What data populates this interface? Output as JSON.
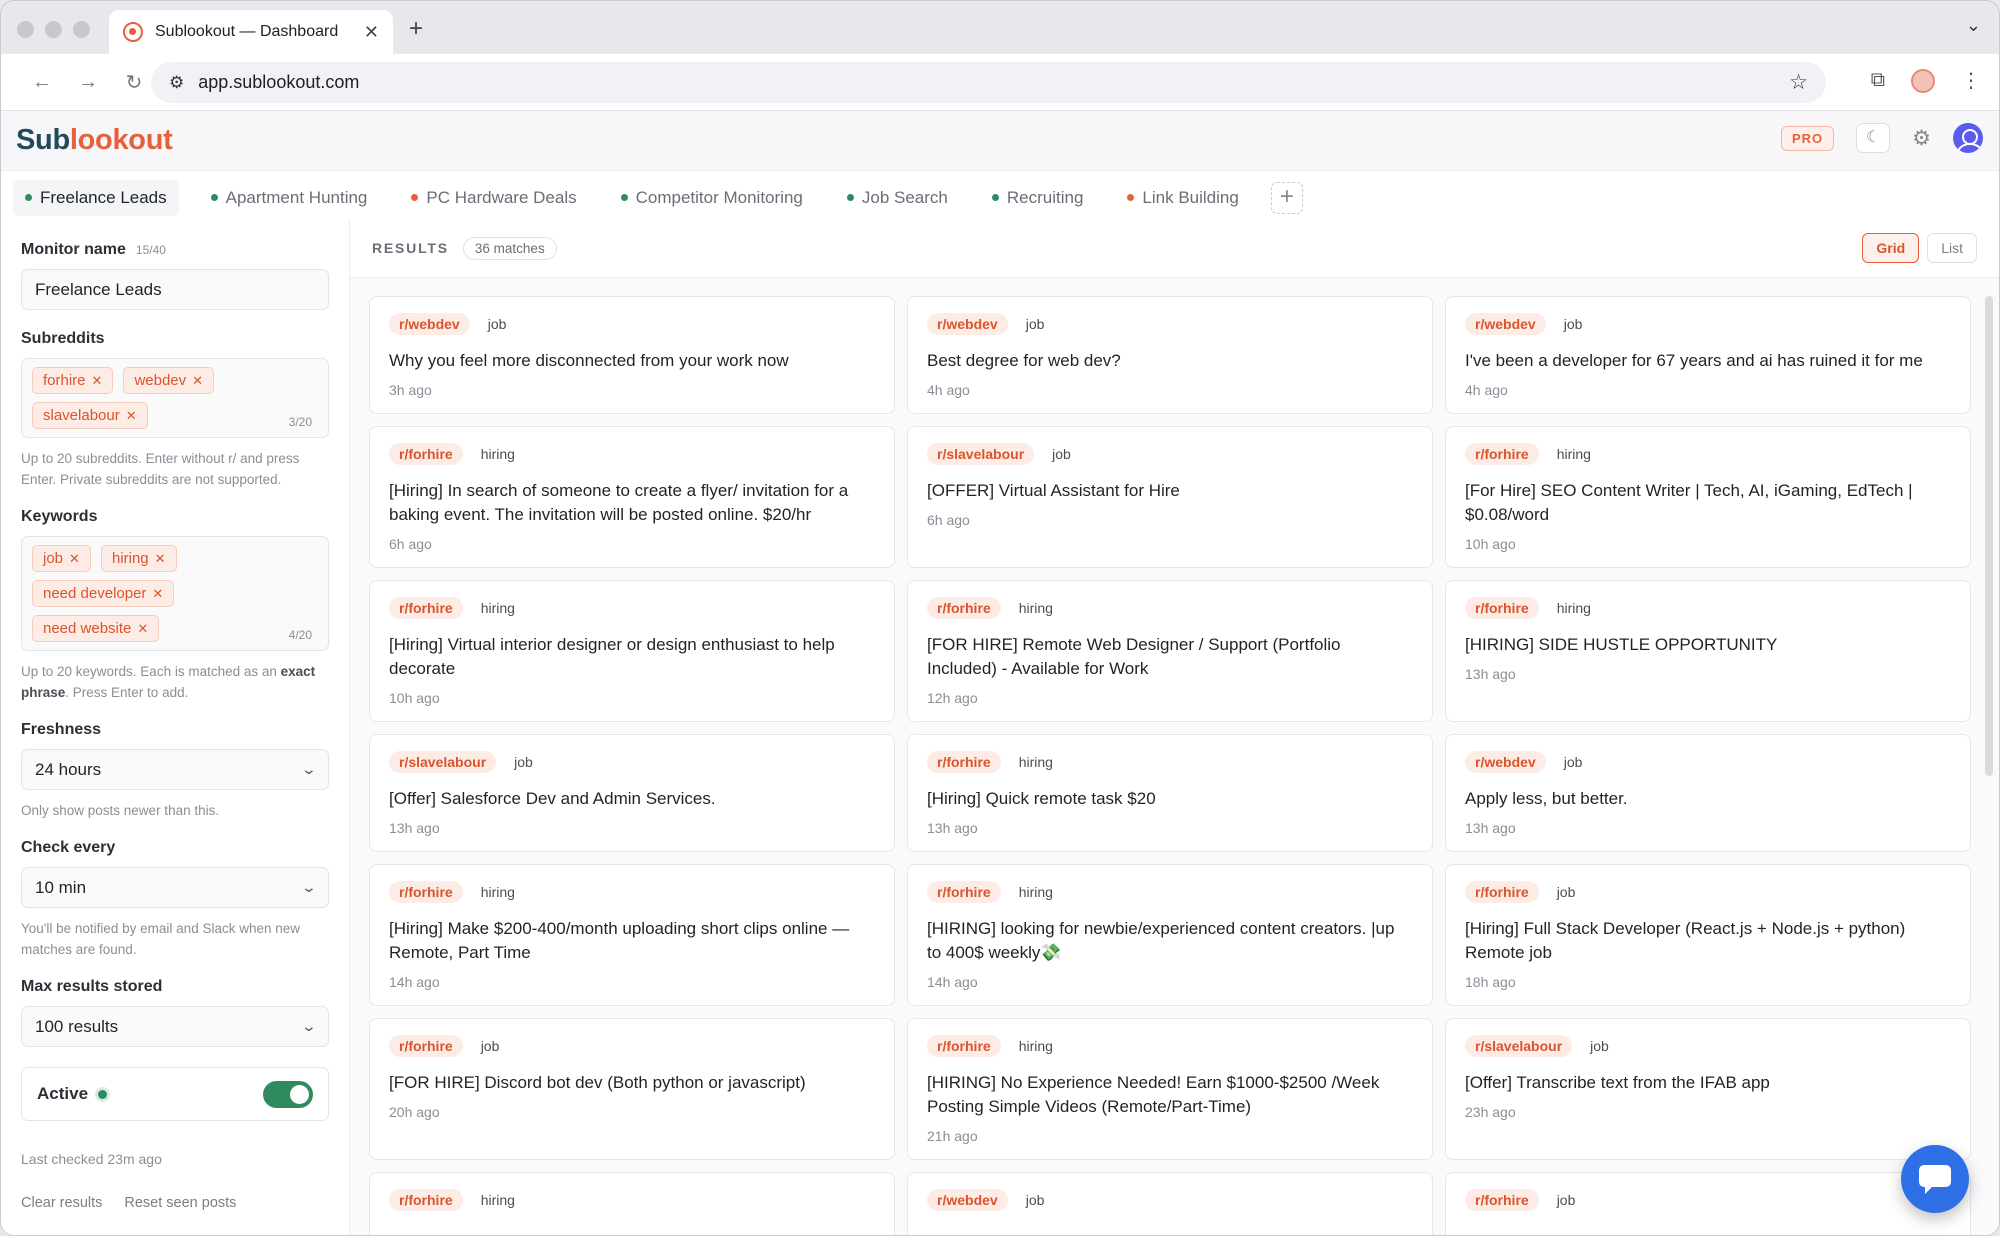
{
  "browser": {
    "tab_title": "Sublookout — Dashboard",
    "url": "app.sublookout.com"
  },
  "app": {
    "logo_part1": "Sub",
    "logo_part2": "lookout",
    "pro_badge": "PRO",
    "accent_color": "#e8603a"
  },
  "monitor_tabs": [
    {
      "label": "Freelance Leads",
      "dot": "green",
      "active": true
    },
    {
      "label": "Apartment Hunting",
      "dot": "green"
    },
    {
      "label": "PC Hardware Deals",
      "dot": "orange"
    },
    {
      "label": "Competitor Monitoring",
      "dot": "green"
    },
    {
      "label": "Job Search",
      "dot": "green"
    },
    {
      "label": "Recruiting",
      "dot": "green"
    },
    {
      "label": "Link Building",
      "dot": "orange"
    }
  ],
  "sidebar": {
    "monitor_name_label": "Monitor name",
    "monitor_name_count": "15/40",
    "monitor_name_value": "Freelance Leads",
    "subreddits_label": "Subreddits",
    "subreddits": [
      "forhire",
      "webdev",
      "slavelabour"
    ],
    "subreddits_count": "3/20",
    "subreddits_help": "Up to 20 subreddits. Enter without r/ and press Enter. Private subreddits are not supported.",
    "keywords_label": "Keywords",
    "keywords": [
      "job",
      "hiring",
      "need developer",
      "need website"
    ],
    "keywords_count": "4/20",
    "keywords_help_1": "Up to 20 keywords. Each is matched as an ",
    "keywords_help_bold": "exact phrase",
    "keywords_help_2": ". Press Enter to add.",
    "freshness_label": "Freshness",
    "freshness_value": "24 hours",
    "freshness_help": "Only show posts newer than this.",
    "check_label": "Check every",
    "check_value": "10 min",
    "check_help": "You'll be notified by email and Slack when new matches are found.",
    "max_label": "Max results stored",
    "max_value": "100 results",
    "active_label": "Active",
    "last_checked": "Last checked 23m ago",
    "clear_results": "Clear results",
    "reset_seen": "Reset seen posts"
  },
  "results": {
    "label": "RESULTS",
    "matches": "36 matches",
    "grid_label": "Grid",
    "list_label": "List",
    "cards": [
      {
        "sub": "r/webdev",
        "kw": "job",
        "title": "Why you feel more disconnected from your work now",
        "time": "3h ago"
      },
      {
        "sub": "r/webdev",
        "kw": "job",
        "title": "Best degree for web dev?",
        "time": "4h ago"
      },
      {
        "sub": "r/webdev",
        "kw": "job",
        "title": "I've been a developer for 67 years and ai has ruined it for me",
        "time": "4h ago"
      },
      {
        "sub": "r/forhire",
        "kw": "hiring",
        "title": "[Hiring] In search of someone to create a flyer/ invitation for a baking event. The invitation will be posted online. $20/hr",
        "time": "6h ago"
      },
      {
        "sub": "r/slavelabour",
        "kw": "job",
        "title": "[OFFER] Virtual Assistant for Hire",
        "time": "6h ago"
      },
      {
        "sub": "r/forhire",
        "kw": "hiring",
        "title": "[For Hire] SEO Content Writer | Tech, AI, iGaming, EdTech | $0.08/word",
        "time": "10h ago"
      },
      {
        "sub": "r/forhire",
        "kw": "hiring",
        "title": "[Hiring] Virtual interior designer or design enthusiast to help decorate",
        "time": "10h ago"
      },
      {
        "sub": "r/forhire",
        "kw": "hiring",
        "title": "[FOR HIRE] Remote Web Designer / Support (Portfolio Included) - Available for Work",
        "time": "12h ago"
      },
      {
        "sub": "r/forhire",
        "kw": "hiring",
        "title": "[HIRING] SIDE HUSTLE OPPORTUNITY",
        "time": "13h ago"
      },
      {
        "sub": "r/slavelabour",
        "kw": "job",
        "title": "[Offer] Salesforce Dev and Admin Services.",
        "time": "13h ago"
      },
      {
        "sub": "r/forhire",
        "kw": "hiring",
        "title": "[Hiring] Quick remote task $20",
        "time": "13h ago"
      },
      {
        "sub": "r/webdev",
        "kw": "job",
        "title": "Apply less, but better.",
        "time": "13h ago"
      },
      {
        "sub": "r/forhire",
        "kw": "hiring",
        "title": "[Hiring] Make $200-400/month uploading short clips online — Remote, Part Time",
        "time": "14h ago"
      },
      {
        "sub": "r/forhire",
        "kw": "hiring",
        "title": "[HIRING] looking for newbie/experienced content creators. |up to 400$ weekly💸",
        "time": "14h ago"
      },
      {
        "sub": "r/forhire",
        "kw": "job",
        "title": "[Hiring] Full Stack Developer (React.js + Node.js + python) Remote job",
        "time": "18h ago"
      },
      {
        "sub": "r/forhire",
        "kw": "job",
        "title": "[FOR HIRE] Discord bot dev (Both python or javascript)",
        "time": "20h ago"
      },
      {
        "sub": "r/forhire",
        "kw": "hiring",
        "title": "[HIRING] No Experience Needed! Earn $1000-$2500 /Week Posting Simple Videos (Remote/Part-Time)",
        "time": "21h ago"
      },
      {
        "sub": "r/slavelabour",
        "kw": "job",
        "title": "[Offer] Transcribe text from the IFAB app",
        "time": "23h ago"
      },
      {
        "sub": "r/forhire",
        "kw": "hiring",
        "title": "",
        "time": ""
      },
      {
        "sub": "r/webdev",
        "kw": "job",
        "title": "",
        "time": ""
      },
      {
        "sub": "r/forhire",
        "kw": "job",
        "title": "",
        "time": ""
      }
    ]
  }
}
